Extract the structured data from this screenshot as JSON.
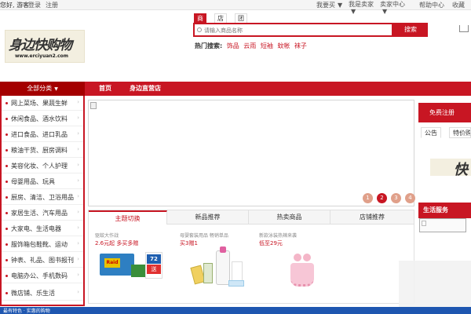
{
  "topbar": {
    "greeting": "您好, 游客",
    "login": "登录",
    "register": "注册",
    "i_buy": "我要买",
    "i_sell": "我是卖家",
    "seller_center": "卖家中心",
    "help": "帮助中心",
    "favorite": "收藏",
    "chevron": "▼"
  },
  "logo": {
    "text": "身边快购物",
    "url": "www.erciyuan2.com"
  },
  "search": {
    "tabs": [
      "商品",
      "店铺",
      "团购"
    ],
    "placeholder": "请输入商品名称",
    "button": "搜索",
    "hot_label": "热门搜索:",
    "hot_keywords": [
      "饰品",
      "云雨",
      "短袖",
      "蚊帐",
      "袜子"
    ]
  },
  "nav": {
    "all_categories": "全部分类",
    "links": [
      "首页",
      "身边直营店"
    ]
  },
  "categories": [
    "网上菜场、果蔬生鲜",
    "休闲食品、酒水饮料",
    "进口食品、进口乳品",
    "粮油干货、厨房调料",
    "美容化妆、个人护理",
    "母婴用品、玩具",
    "厨房、清洁、卫浴用品",
    "家居生活、汽车用品",
    "大家电、生活电器",
    "服饰箱包鞋靴、运动",
    "钟表、礼品、图书报刊",
    "电脑办公、手机数码",
    "微店铺、乐生活"
  ],
  "banner": {
    "pages": [
      "1",
      "2",
      "3",
      "4"
    ],
    "active_page": 2
  },
  "bottom_tabs": [
    "主题切换",
    "新品推荐",
    "热卖商品",
    "店铺推荐"
  ],
  "promos": [
    {
      "title": "驱蚊大作战",
      "price": "2.6元起  多买多赠",
      "badge_top": "Raid",
      "badge_num": "72",
      "badge_word": "送"
    },
    {
      "title": "母婴套装用品 畅销单品",
      "price": "买3赠1"
    },
    {
      "title": "新款泳装热辣来袭",
      "price": "低至29元"
    }
  ],
  "right": {
    "register_btn": "免费注册",
    "tabs": [
      "公告",
      "特价购买"
    ],
    "logo_char": "快",
    "life_service": "生活服务"
  },
  "footer": {
    "text": "最有特色 · 实惠的购物"
  },
  "colors": {
    "brand_red": "#c81623",
    "dark_red": "#a40000"
  }
}
